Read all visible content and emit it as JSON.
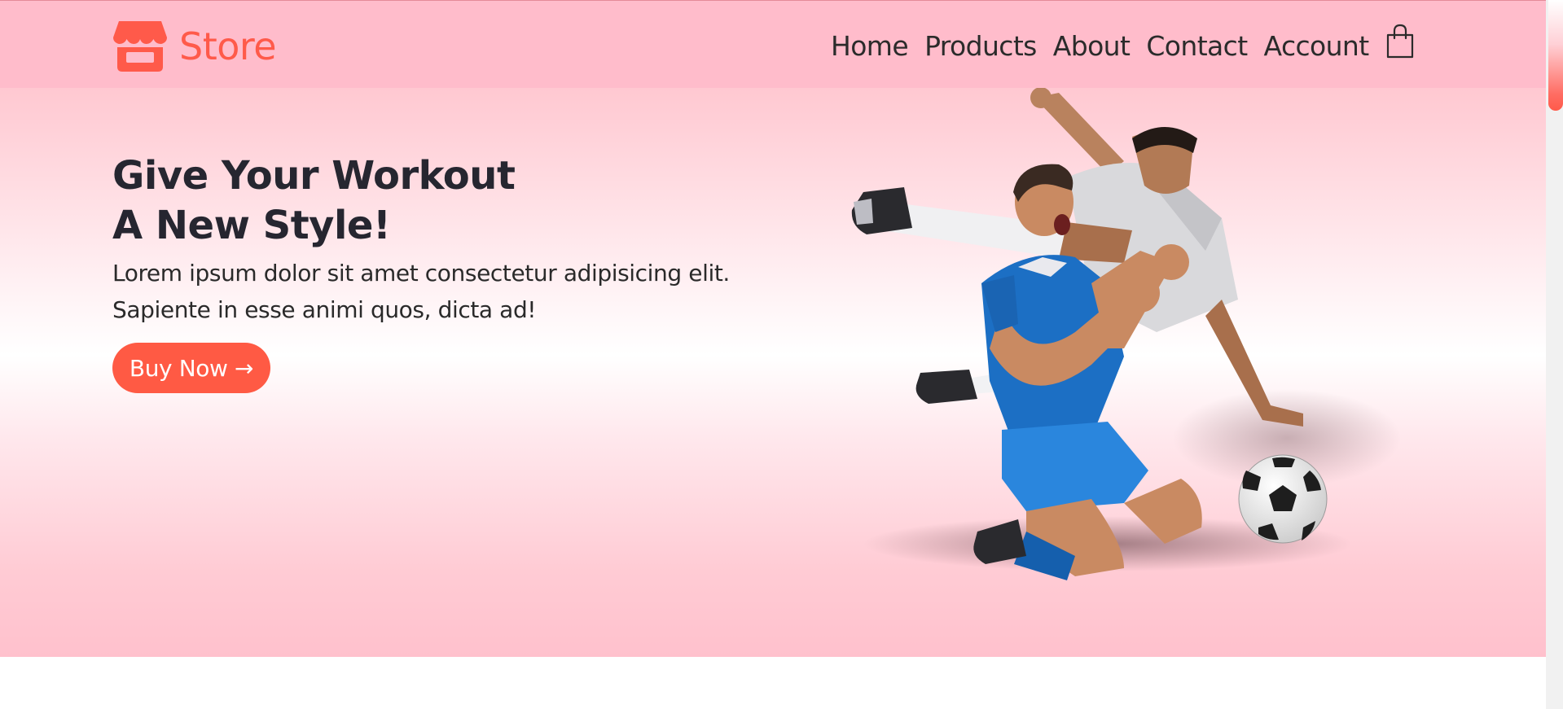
{
  "brand": {
    "name": "Store",
    "icon": "storefront-icon",
    "color": "#ff5a4a"
  },
  "nav": {
    "items": [
      {
        "label": "Home"
      },
      {
        "label": "Products"
      },
      {
        "label": "About"
      },
      {
        "label": "Contact"
      },
      {
        "label": "Account"
      }
    ],
    "cart_icon": "shopping-bag-icon"
  },
  "hero": {
    "title_line1": "Give Your Workout",
    "title_line2": "A New Style!",
    "text_line1": "Lorem ipsum dolor sit amet consectetur adipisicing elit.",
    "text_line2": "Sapiente in esse animi quos, dicta ad!",
    "button_label": "Buy Now →",
    "image": "soccer-players-image"
  },
  "colors": {
    "header_bg": "#ffbccb",
    "accent": "#ff5a44",
    "text": "#262630"
  }
}
